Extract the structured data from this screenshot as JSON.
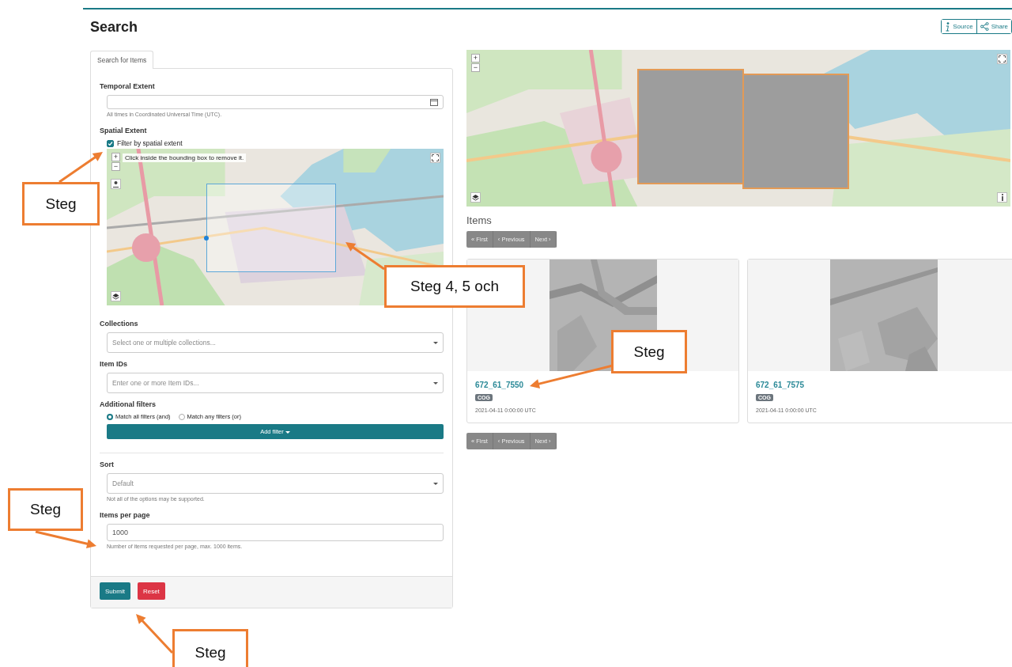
{
  "page": {
    "title": "Search"
  },
  "header_buttons": [
    {
      "label": "Source",
      "kind": "info"
    },
    {
      "label": "Share",
      "kind": "share"
    }
  ],
  "tabs": [
    {
      "label": "Search for Items",
      "selected": true
    }
  ],
  "form": {
    "temporal": {
      "label": "Temporal Extent",
      "hint": "All times in Coordinated Universal Time (UTC)."
    },
    "map_controls": [
      "+",
      "−"
    ],
    "spatial": {
      "label": "Spatial Extent",
      "checkbox_label": "Filter by spatial extent",
      "checked": true,
      "map_hint": "Click inside the bounding box to remove it."
    },
    "collections": {
      "label": "Collections",
      "placeholder": "Select one or multiple collections..."
    },
    "item_ids": {
      "label": "Item IDs",
      "placeholder": "Enter one or more Item IDs..."
    },
    "additional_filters": {
      "label": "Additional filters",
      "options": [
        {
          "label": "Match all filters (and)",
          "selected": true
        },
        {
          "label": "Match any filters (or)",
          "selected": false
        }
      ],
      "add_button": "Add filter"
    },
    "sort": {
      "label": "Sort",
      "value": "Default",
      "hint": "Not all of the options may be supported."
    },
    "items_per_page": {
      "label": "Items per page",
      "value": "1000",
      "hint": "Number of items requested per page, max. 1000 items."
    },
    "buttons": [
      {
        "label": "Submit",
        "kind": "primary"
      },
      {
        "label": "Reset",
        "kind": "danger"
      }
    ]
  },
  "items": {
    "title": "Items",
    "pagination_top": [
      "« First",
      "‹ Previous",
      "Next ›"
    ],
    "cards": [
      {
        "id": "672_61_7550",
        "badge": "COG",
        "datetime": "2021-04-11 0:00:00 UTC"
      },
      {
        "id": "672_61_7575",
        "badge": "COG",
        "datetime": "2021-04-11 0:00:00 UTC"
      }
    ],
    "pagination_bottom": [
      "« First",
      "‹ Previous",
      "Next ›"
    ]
  },
  "annotations": [
    {
      "text": "Steg"
    },
    {
      "text": "Steg 4, 5 och"
    },
    {
      "text": "Steg"
    },
    {
      "text": "Steg"
    },
    {
      "text": "Steg"
    }
  ]
}
